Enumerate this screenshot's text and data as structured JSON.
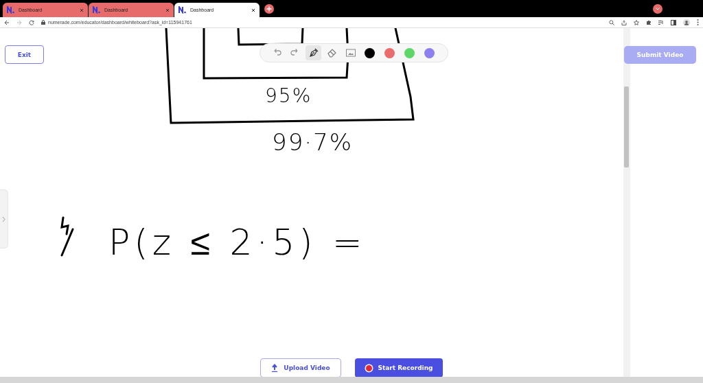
{
  "browser": {
    "tabs": [
      {
        "title": "Dashboard",
        "selected": false
      },
      {
        "title": "Dashboard",
        "selected": false
      },
      {
        "title": "Dashboard",
        "selected": true
      }
    ],
    "url": "numerade.com/educator/dashboard/whiteboard?ask_id=115941761"
  },
  "exit_button": "Exit",
  "toolbar": {
    "tools": [
      {
        "kind": "undo",
        "selected": false
      },
      {
        "kind": "redo",
        "selected": false
      },
      {
        "kind": "pen",
        "selected": true
      },
      {
        "kind": "eraser",
        "selected": false
      },
      {
        "kind": "image",
        "selected": false
      }
    ],
    "colors": [
      {
        "color": "#000000"
      },
      {
        "color": "#ea6b6b"
      },
      {
        "color": "#5fd66a"
      },
      {
        "color": "#8b80ee"
      }
    ]
  },
  "whiteboard": {
    "notes": [
      "95%",
      "99·7%",
      "P(z ≤ 2·5) ="
    ]
  },
  "submit_button": {
    "label": "Submit Video",
    "disabled": true
  },
  "upload_button": "Upload Video",
  "record_button": "Start Recording"
}
